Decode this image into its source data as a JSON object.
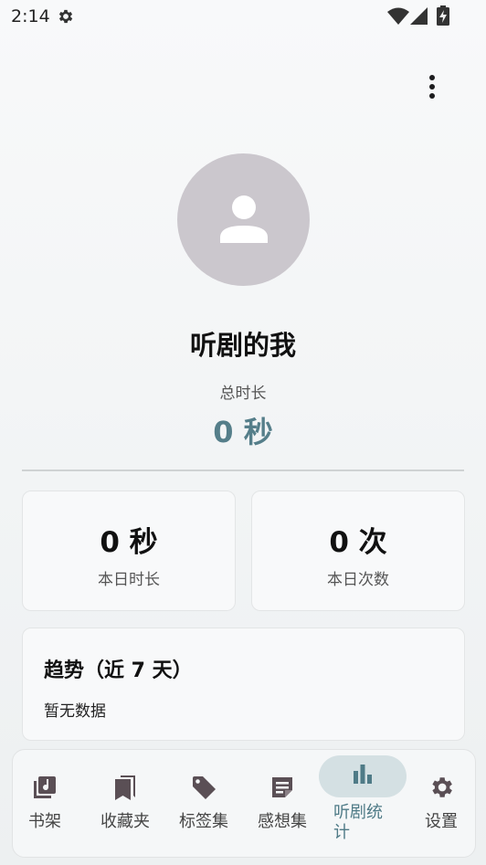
{
  "status_bar": {
    "time": "2:14"
  },
  "profile": {
    "name": "听剧的我",
    "total_label": "总时长",
    "total_value": "0 秒"
  },
  "stats": {
    "today_duration": {
      "value": "0 秒",
      "label": "本日时长"
    },
    "today_count": {
      "value": "0 次",
      "label": "本日次数"
    }
  },
  "trend": {
    "title": "趋势（近 7 天）",
    "empty_text": "暂无数据"
  },
  "nav": [
    {
      "label": "书架",
      "icon": "bookshelf-music-icon"
    },
    {
      "label": "收藏夹",
      "icon": "bookmarks-icon"
    },
    {
      "label": "标签集",
      "icon": "tag-icon"
    },
    {
      "label": "感想集",
      "icon": "note-icon"
    },
    {
      "label": "听剧统计",
      "icon": "bar-chart-icon",
      "active": true
    },
    {
      "label": "设置",
      "icon": "gear-icon"
    }
  ],
  "colors": {
    "accent": "#557e8a",
    "active_pill": "#d4e0e3",
    "avatar_bg": "#cbc7cd"
  }
}
